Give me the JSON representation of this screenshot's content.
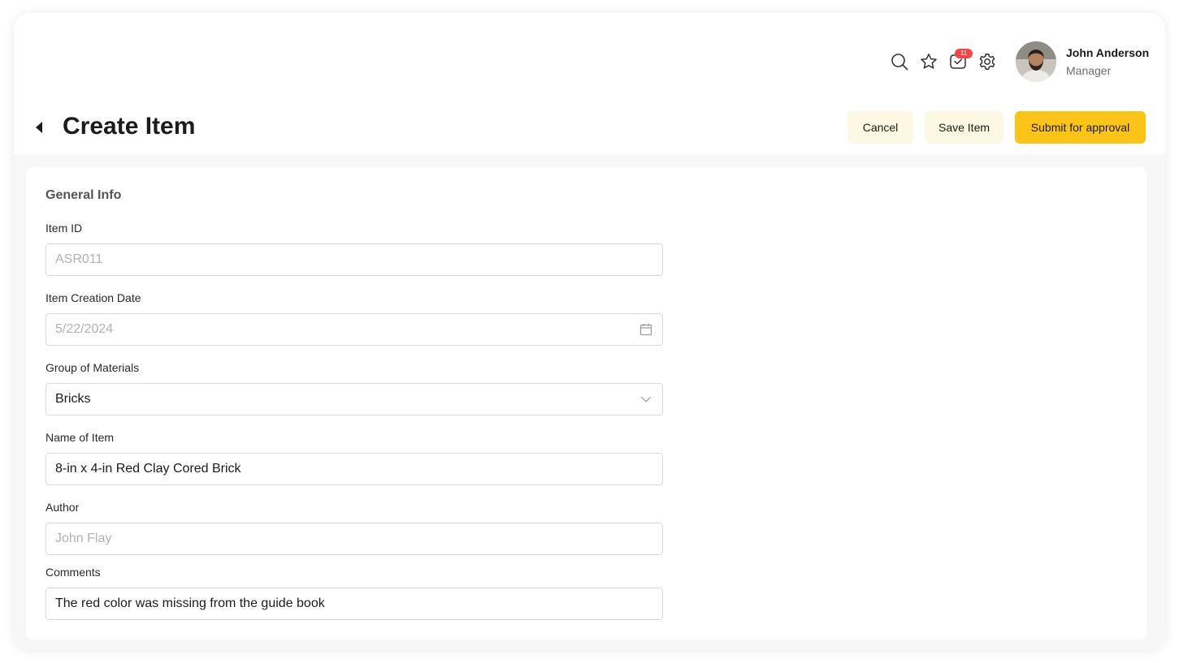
{
  "user": {
    "name": "John Anderson",
    "role": "Manager",
    "notification_count": "11"
  },
  "icons": {
    "search": "search-icon",
    "favorites": "star-icon",
    "inbox": "inbox-icon",
    "settings": "gear-icon",
    "back": "back-arrow-icon",
    "calendar": "calendar-icon",
    "dropdown": "chevron-down-icon"
  },
  "page": {
    "title": "Create Item"
  },
  "actions": {
    "cancel": "Cancel",
    "save": "Save Item",
    "submit": "Submit for approval"
  },
  "form": {
    "section_title": "General Info",
    "fields": {
      "item_id": {
        "label": "Item ID",
        "placeholder": "ASR011",
        "value": ""
      },
      "creation_date": {
        "label": "Item Creation Date",
        "placeholder": "5/22/2024",
        "value": ""
      },
      "group": {
        "label": "Group of Materials",
        "value": "Bricks"
      },
      "name": {
        "label": "Name of Item",
        "value": "8-in x 4-in Red Clay Cored Brick"
      },
      "author": {
        "label": "Author",
        "placeholder": "John Flay",
        "value": ""
      },
      "comments": {
        "label": "Comments",
        "value": "The red color was missing from the guide book"
      }
    }
  },
  "colors": {
    "accent": "#fcc419",
    "secondary_button": "#fdf8e3",
    "badge": "#f04848",
    "page_background": "#f7f7f8"
  }
}
